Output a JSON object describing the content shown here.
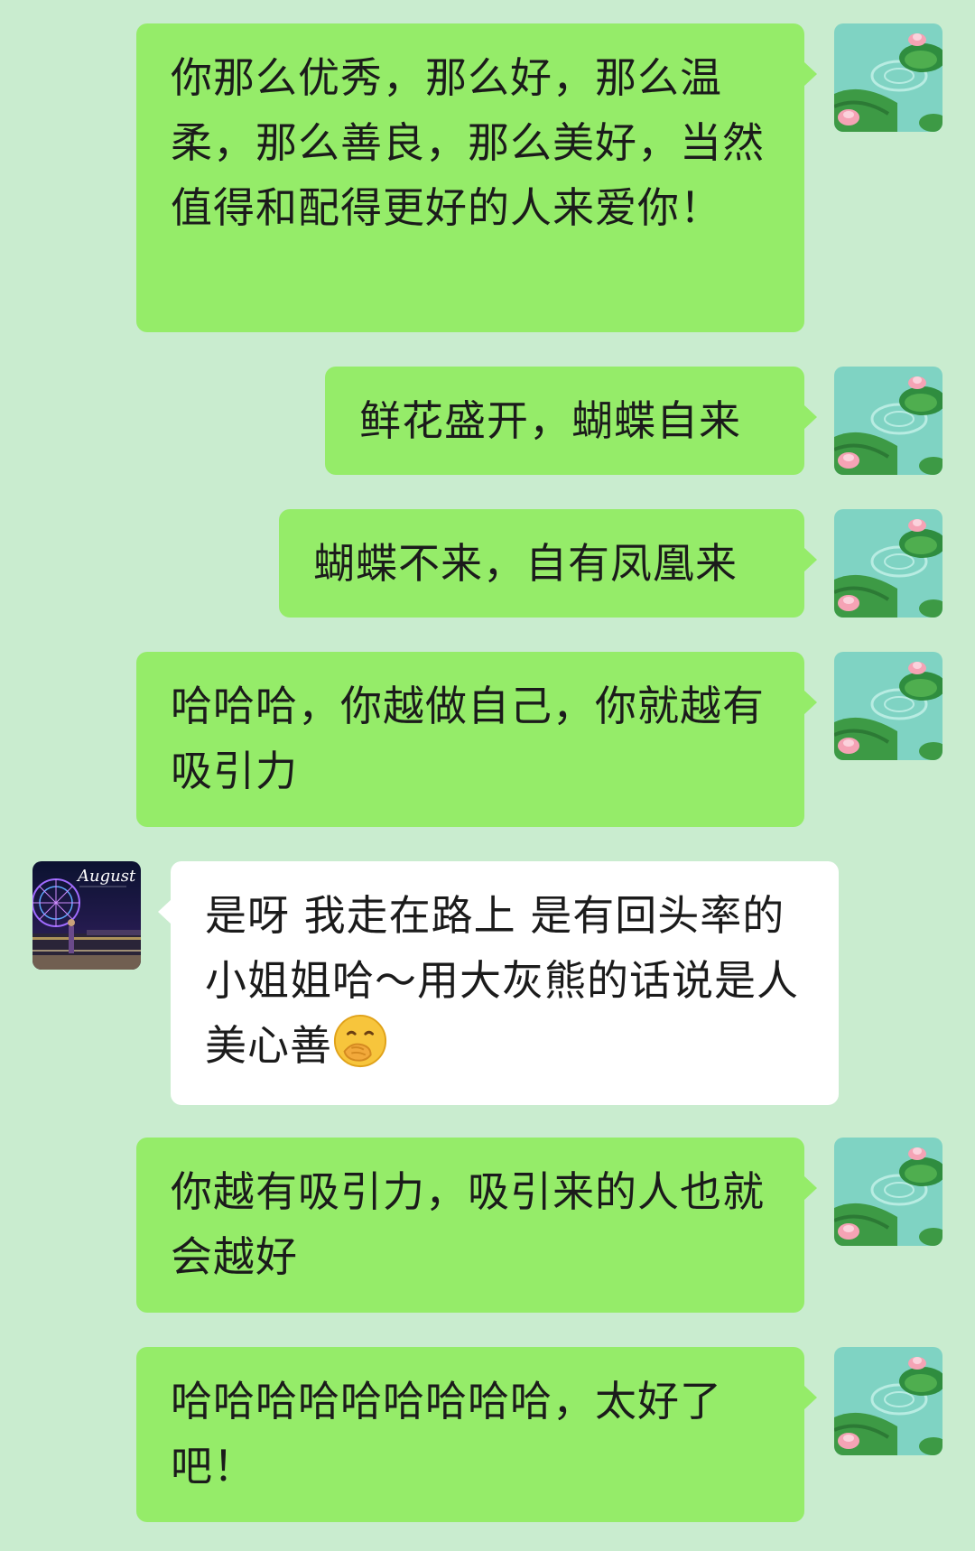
{
  "messages": [
    {
      "sender": "self",
      "text": "你那么优秀，那么好，那么温柔，那么善良，那么美好，当然值得和配得更好的人来爱你！"
    },
    {
      "sender": "self",
      "text": "鲜花盛开，蝴蝶自来"
    },
    {
      "sender": "self",
      "text": "蝴蝶不来，自有凤凰来"
    },
    {
      "sender": "self",
      "text": "哈哈哈，你越做自己，你就越有吸引力"
    },
    {
      "sender": "other",
      "text": "是呀 我走在路上 是有回头率的小姐姐哈～用大灰熊的话说是人美心善",
      "emoji": "hand-over-mouth-emoji"
    },
    {
      "sender": "self",
      "text": "你越有吸引力，吸引来的人也就会越好"
    },
    {
      "sender": "self",
      "text": "哈哈哈哈哈哈哈哈哈，太好了吧！"
    }
  ],
  "other_avatar": {
    "text": "August",
    "icon": "ferris-wheel-night-avatar"
  },
  "self_avatar": {
    "icon": "lotus-pond-avatar"
  },
  "colors": {
    "background": "#c9eccf",
    "outgoing_bubble": "#95ec69",
    "incoming_bubble": "#ffffff"
  }
}
